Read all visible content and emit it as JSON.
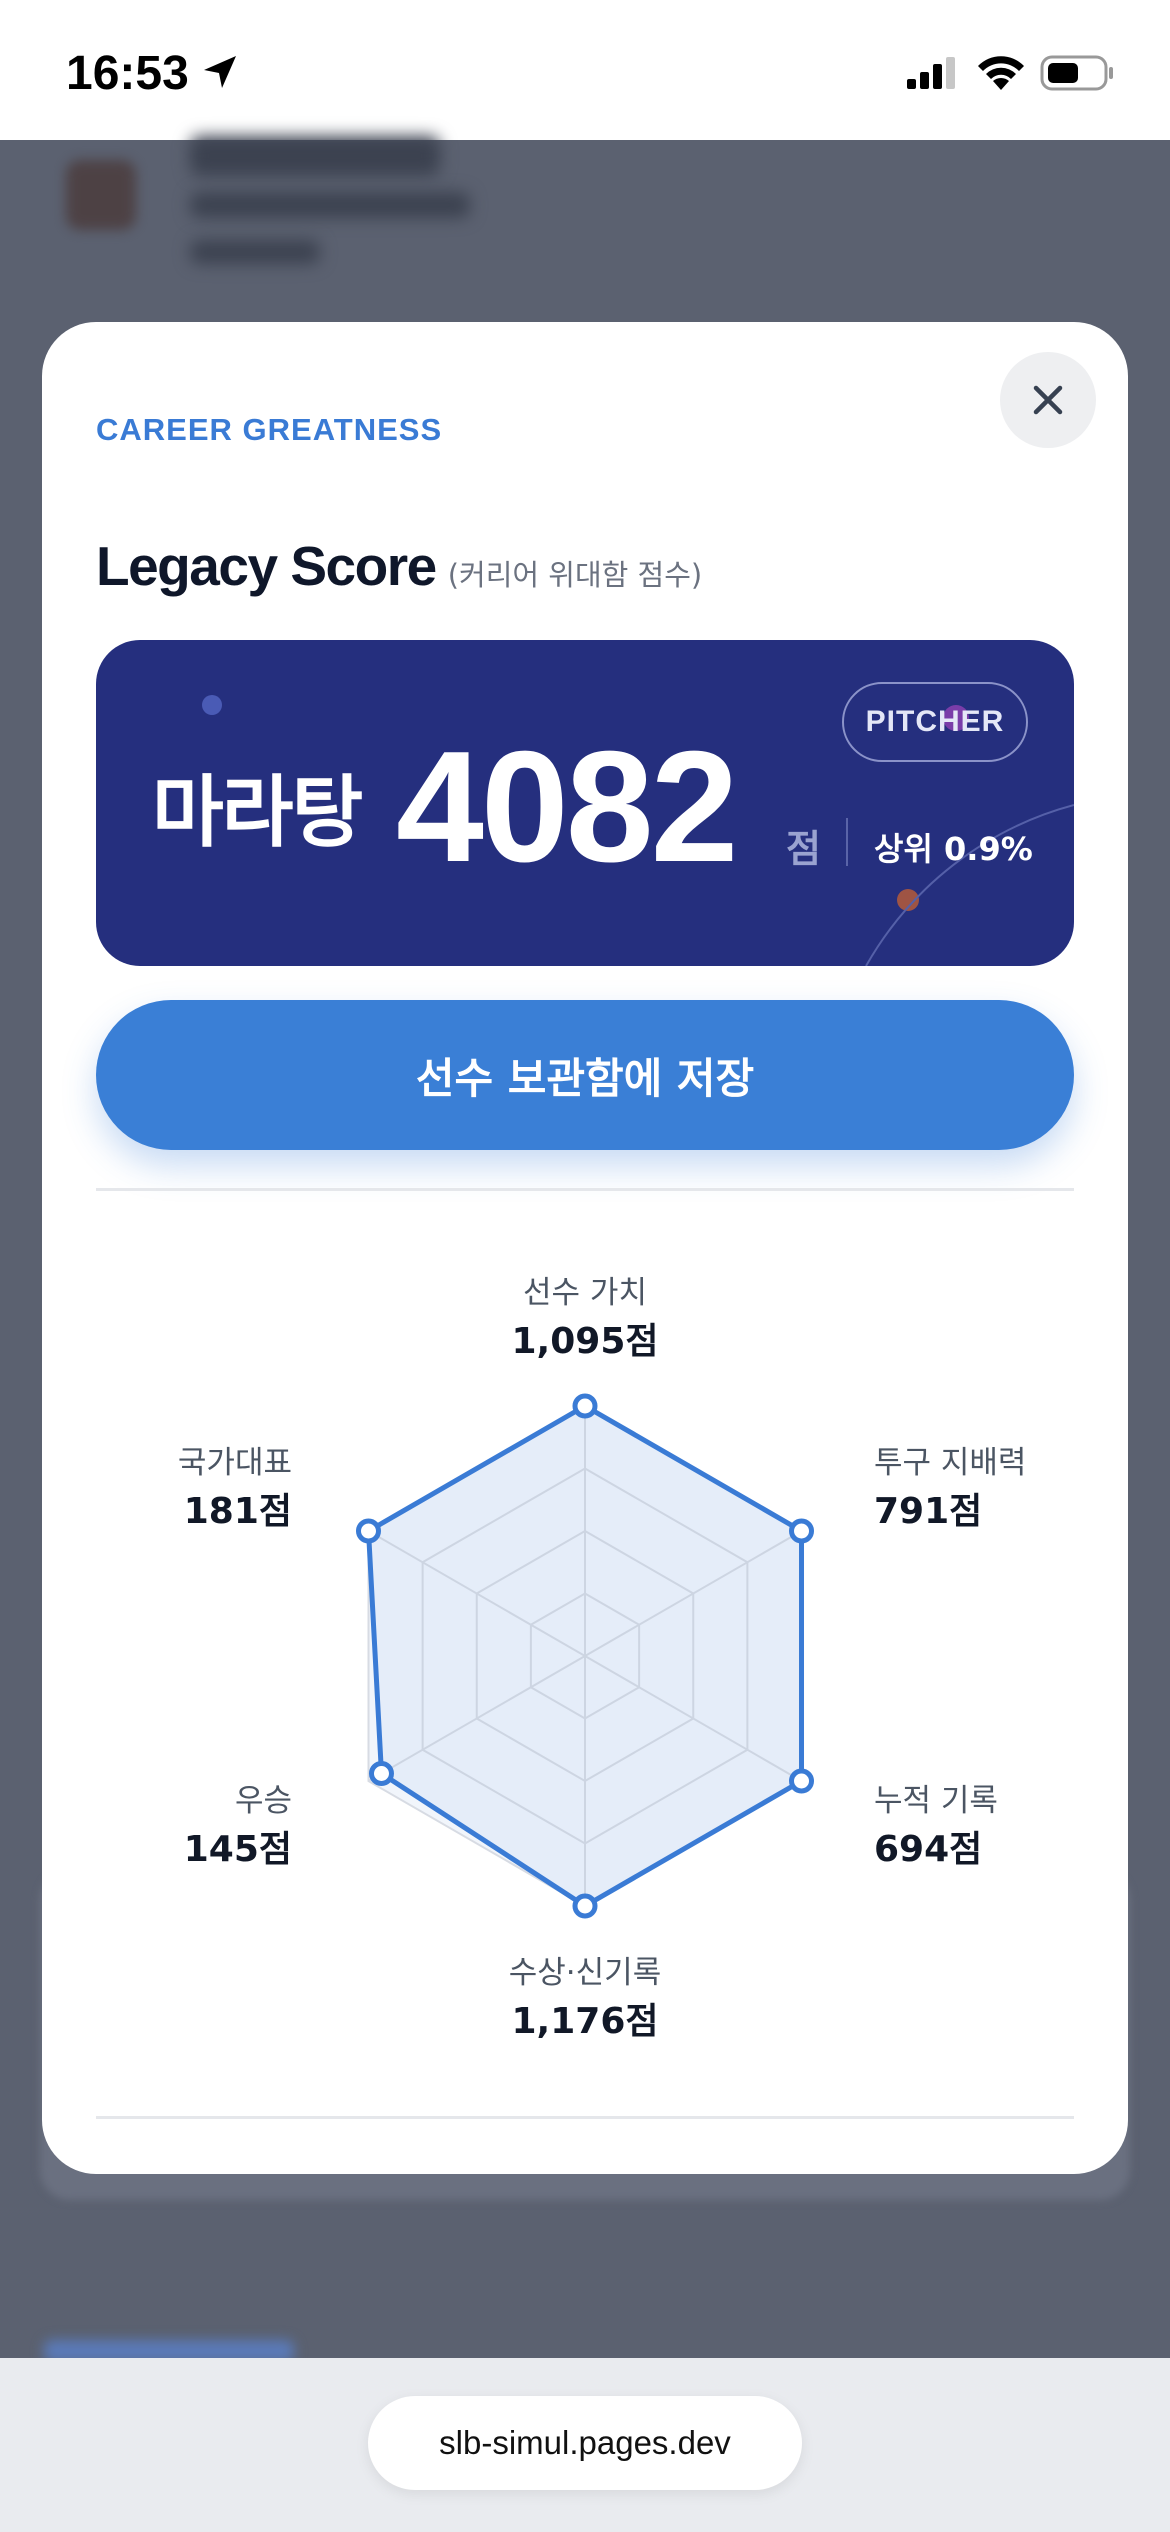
{
  "status_bar": {
    "time": "16:53"
  },
  "modal": {
    "eyebrow": "CAREER GREATNESS",
    "title": "Legacy Score",
    "subtitle": "(커리어 위대함 점수)",
    "close_icon": "close-icon"
  },
  "score_card": {
    "player_name": "마라탕",
    "score": "4082",
    "unit": "점",
    "rank": "상위 0.9%",
    "position": "PITCHER",
    "colors": {
      "background": "#252f7e",
      "accent": "#3a7fd6"
    }
  },
  "save_button": {
    "label": "선수 보관함에 저장"
  },
  "radar": {
    "axes": [
      {
        "name": "선수 가치",
        "value_label": "1,095점",
        "value": 1095,
        "level": 1.0
      },
      {
        "name": "투구 지배력",
        "value_label": "791점",
        "value": 791,
        "level": 1.0
      },
      {
        "name": "누적 기록",
        "value_label": "694점",
        "value": 694,
        "level": 1.0
      },
      {
        "name": "수상·신기록",
        "value_label": "1,176점",
        "value": 1176,
        "level": 1.0
      },
      {
        "name": "우승",
        "value_label": "145점",
        "value": 145,
        "level": 0.94
      },
      {
        "name": "국가대표",
        "value_label": "181점",
        "value": 181,
        "level": 1.0
      }
    ],
    "rings": 4,
    "color": "#3a7bd5"
  },
  "browser": {
    "url": "slb-simul.pages.dev"
  }
}
